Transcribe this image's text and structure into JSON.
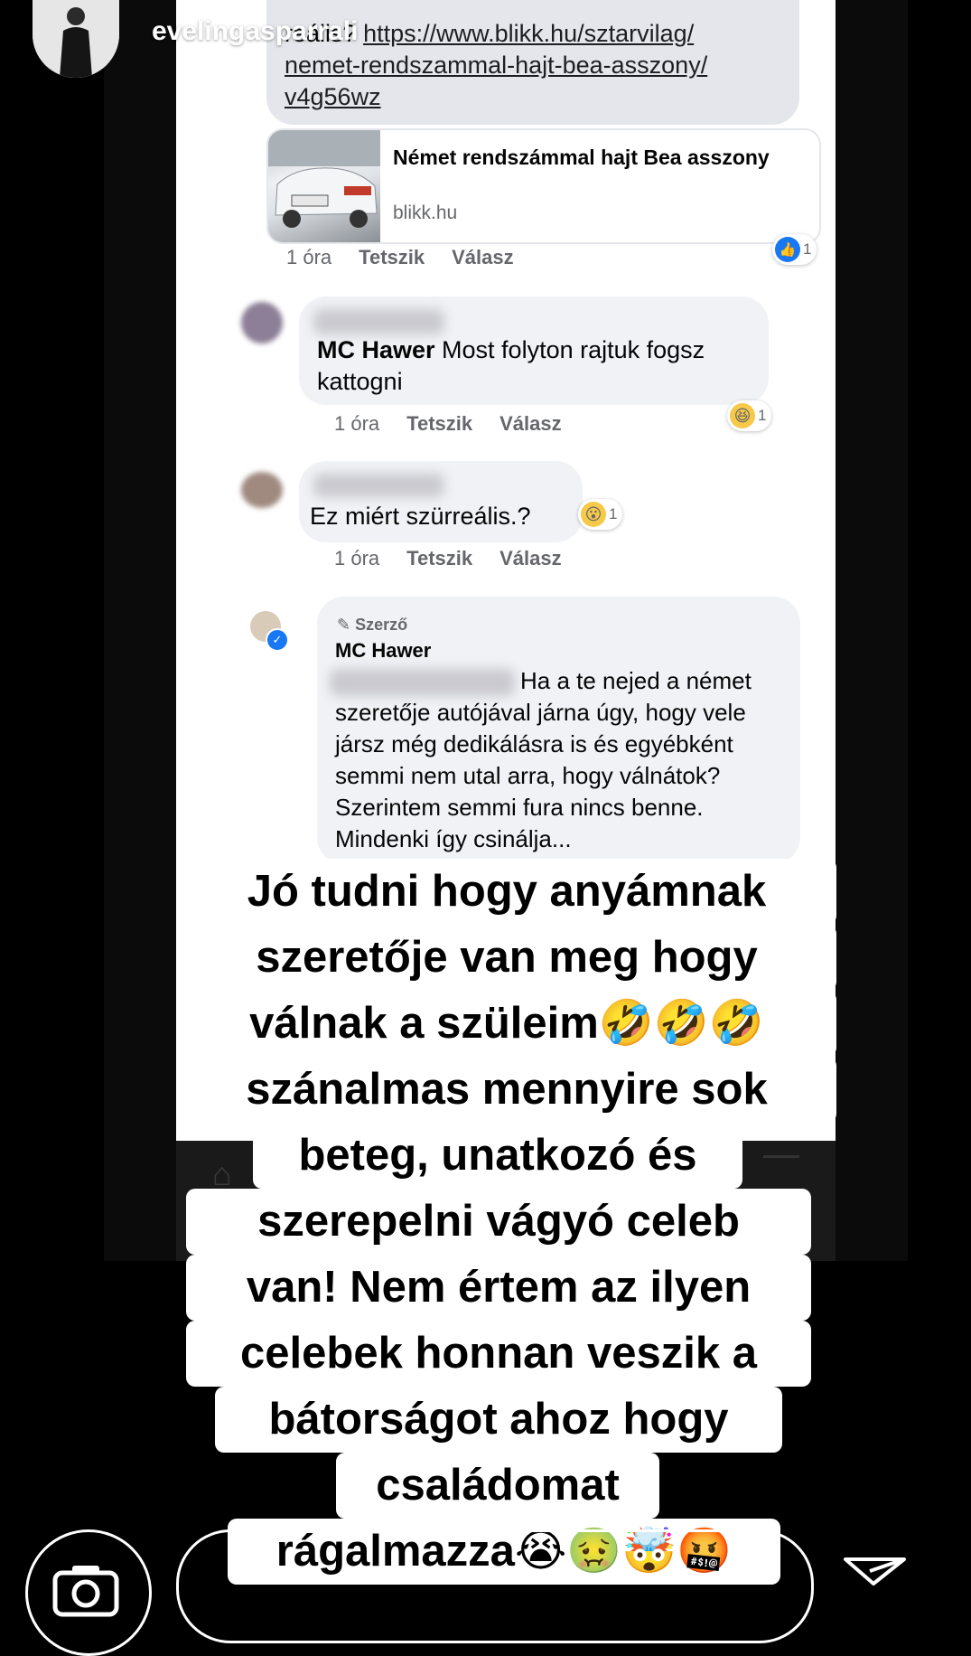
{
  "story": {
    "username": "evelingasparrali",
    "send_icon": "paper-plane-icon",
    "camera_icon": "camera-icon"
  },
  "post": {
    "link_line1_prefix": "reális?",
    "link_line1": "https://www.blikk.hu/sztarvilag/",
    "link_line2": "nemet-rendszammal-hajt-bea-asszony/",
    "link_line3": "v4g56wz",
    "card_title": "Német rendszámmal hajt Bea asszony",
    "card_domain": "blikk.hu",
    "meta_time": "1 óra",
    "meta_like": "Tetszik",
    "meta_reply": "Válasz",
    "reaction_count": "1"
  },
  "comments": [
    {
      "name": "MC Hawer",
      "text": "Most folyton rajtuk fogsz kattogni",
      "time": "1 óra",
      "like": "Tetszik",
      "reply": "Válasz",
      "reaction_count": "1",
      "reaction_icon": "laughing-emoji-icon"
    },
    {
      "text": "Ez miért szürreális.?",
      "time": "1 óra",
      "like": "Tetszik",
      "reply": "Válasz",
      "reaction_count": "1",
      "reaction_icon": "wow-emoji-icon"
    },
    {
      "badge": "Szerző",
      "name": "MC Hawer",
      "text_line1": "Ha a te nejed a német",
      "text_rest": "szeretője autójával járna úgy, hogy vele jársz még dedikálásra is és egyébként semmi nem utal arra, hogy válnátok? Szerintem semmi fura nincs benne. Mindenki így csinálja..."
    }
  ],
  "overlay_text": [
    "Jó tudni hogy anyámnak",
    "szeretője van meg hogy",
    "válnak a szüleim🤣🤣🤣",
    "szánalmas mennyire sok",
    "beteg, unatkozó és",
    "szerepelni vágyó celeb",
    "van! Nem értem az ilyen",
    "celebek honnan veszik a",
    "bátorságot ahoz hogy",
    "családomat",
    "rágalmazza😭🤢🤯🤬"
  ]
}
